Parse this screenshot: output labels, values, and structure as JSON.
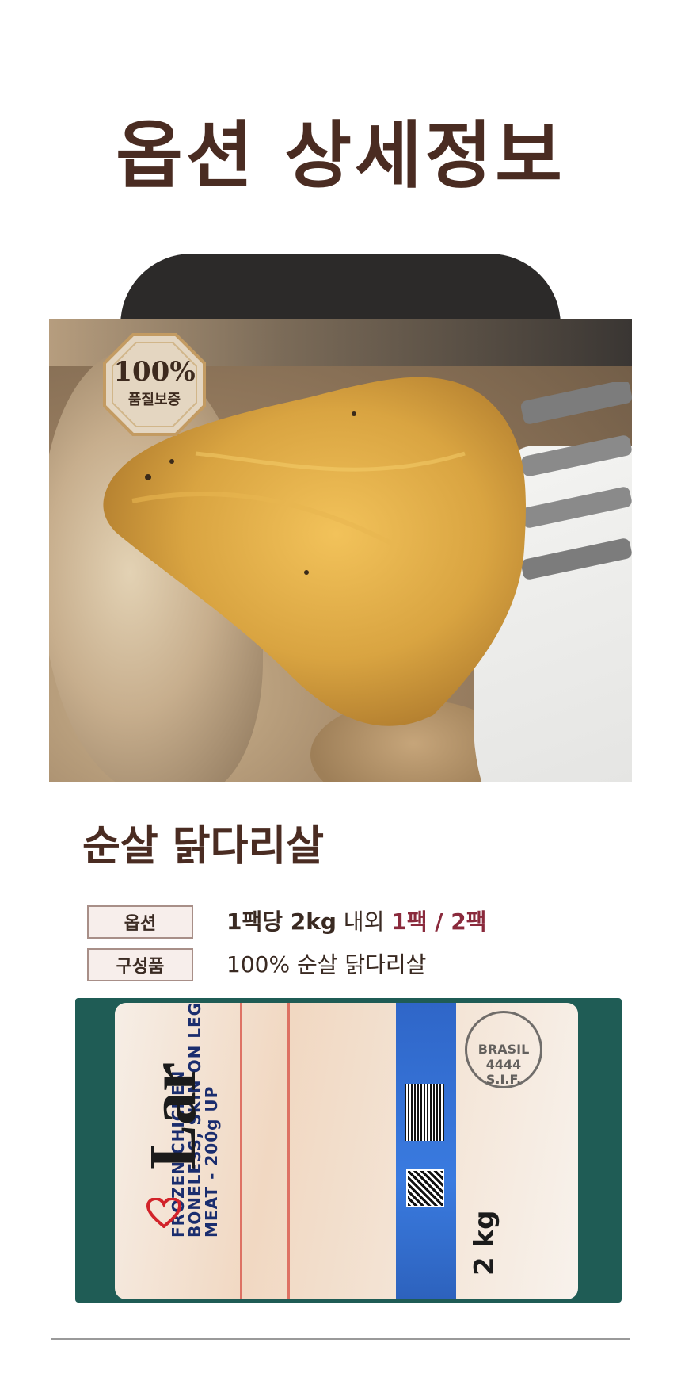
{
  "page_title": "옵션 상세정보",
  "hero": {
    "badge_percent": "100%",
    "badge_label": "품질보증"
  },
  "product": {
    "name": "순살 닭다리살"
  },
  "specs": [
    {
      "label": "옵션",
      "value_bold": "1팩당 2kg",
      "value_text": " 내외 ",
      "value_accent": "1팩 / 2팩"
    },
    {
      "label": "구성품",
      "value_text": "100% 순살 닭다리살"
    }
  ],
  "package": {
    "brand": "Lar",
    "product_text": "FROZEN CHICKEN BONELESS, SKIN ON LEG MEAT - 200g UP",
    "weight": "2 kg",
    "stamp_text": "BRASIL 4444 S.I.F."
  },
  "colors": {
    "title_brown": "#4a2c22",
    "accent_red": "#8a2a3c",
    "label_bg": "#f7eeeb",
    "label_border": "#a88f88",
    "package_bg": "#1f5c55"
  }
}
